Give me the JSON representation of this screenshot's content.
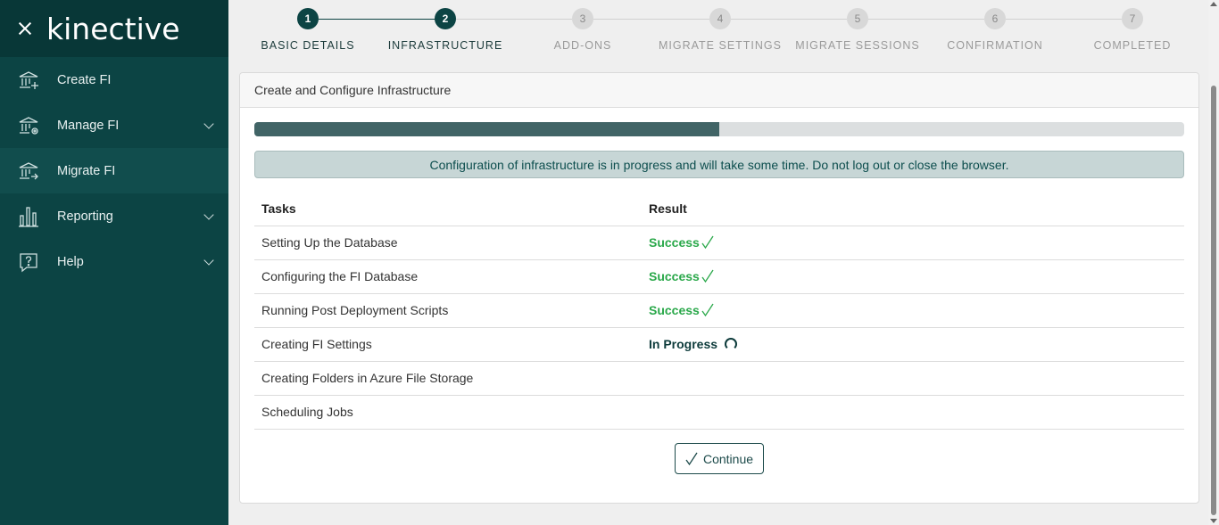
{
  "sidebar": {
    "logo": "kinective",
    "items": [
      {
        "label": "Create FI",
        "icon": "bank-add-icon",
        "has_chevron": false,
        "active": false
      },
      {
        "label": "Manage FI",
        "icon": "bank-gear-icon",
        "has_chevron": true,
        "active": false
      },
      {
        "label": "Migrate FI",
        "icon": "bank-arrow-icon",
        "has_chevron": false,
        "active": true
      },
      {
        "label": "Reporting",
        "icon": "bar-chart-icon",
        "has_chevron": true,
        "active": false
      },
      {
        "label": "Help",
        "icon": "help-bubble-icon",
        "has_chevron": true,
        "active": false
      }
    ]
  },
  "stepper": {
    "steps": [
      {
        "number": "1",
        "label": "BASIC DETAILS",
        "state": "done"
      },
      {
        "number": "2",
        "label": "INFRASTRUCTURE",
        "state": "current"
      },
      {
        "number": "3",
        "label": "ADD-ONS",
        "state": "todo"
      },
      {
        "number": "4",
        "label": "MIGRATE SETTINGS",
        "state": "todo"
      },
      {
        "number": "5",
        "label": "MIGRATE SESSIONS",
        "state": "todo"
      },
      {
        "number": "6",
        "label": "CONFIRMATION",
        "state": "todo"
      },
      {
        "number": "7",
        "label": "COMPLETED",
        "state": "todo"
      }
    ]
  },
  "card": {
    "title": "Create and Configure Infrastructure",
    "progress_fraction": 0.5,
    "alert": "Configuration of infrastructure is in progress and will take some time. Do not log out or close the browser.",
    "table": {
      "headers": [
        "Tasks",
        "Result"
      ],
      "rows": [
        {
          "task": "Setting Up the Database",
          "result": "Success",
          "status": "success"
        },
        {
          "task": "Configuring the FI Database",
          "result": "Success",
          "status": "success"
        },
        {
          "task": "Running Post Deployment Scripts",
          "result": "Success",
          "status": "success"
        },
        {
          "task": "Creating FI Settings",
          "result": "In Progress",
          "status": "progress"
        },
        {
          "task": "Creating Folders in Azure File Storage",
          "result": "",
          "status": "none"
        },
        {
          "task": "Scheduling Jobs",
          "result": "",
          "status": "none"
        }
      ]
    },
    "continue_label": "Continue"
  },
  "colors": {
    "sidebar_bg": "#0c4444",
    "accent": "#0c4444",
    "success": "#2aa84a",
    "progress_fill": "#416466"
  }
}
